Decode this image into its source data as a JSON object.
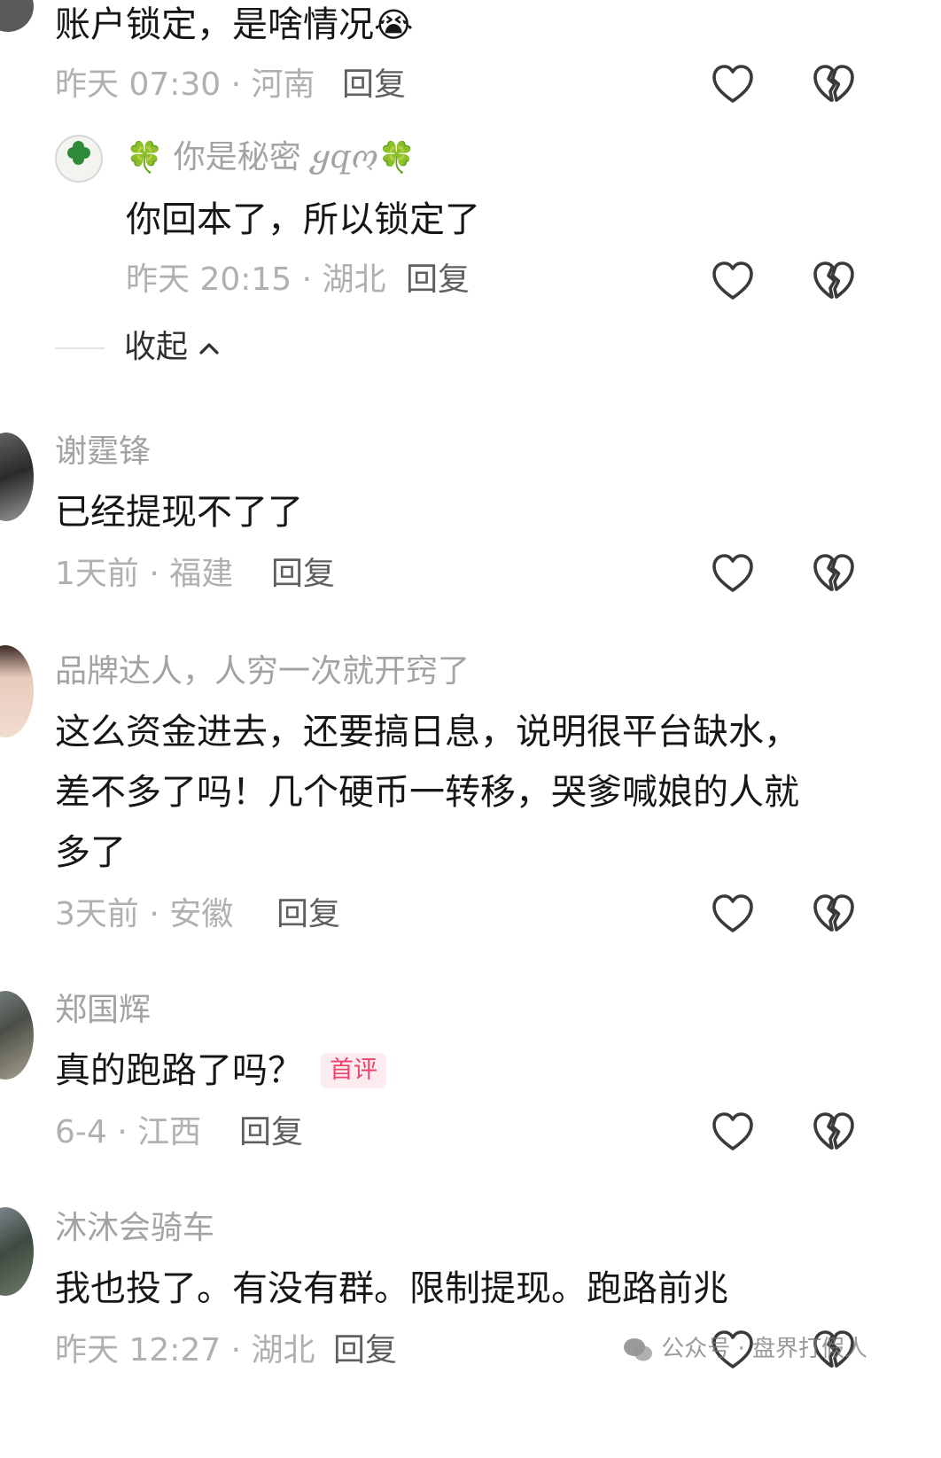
{
  "comments": [
    {
      "text": "账户锁定，是啥情况",
      "emoji": "😭",
      "meta": "昨天 07:30 · 河南",
      "reply": "回复",
      "replies": [
        {
          "user_prefix": "🍀",
          "user": "你是秘密",
          "user_suffix_script": "ყզო",
          "user_suffix": "🍀",
          "text": "你回本了，所以锁定了",
          "meta": "昨天 20:15 · 湖北",
          "reply": "回复"
        }
      ],
      "collapse": "收起",
      "collapse_icon": "chevron-up-icon"
    },
    {
      "user": "谢霆锋",
      "text": "已经提现不了了",
      "meta": "1天前 · 福建",
      "reply": "回复"
    },
    {
      "user": "品牌达人，人穷一次就开窍了",
      "text_lines": [
        "这么资金进去，还要搞日息，说明很平台缺水，",
        "差不多了吗！几个硬币一转移，哭爹喊娘的人就",
        "多了"
      ],
      "meta": "3天前 · 安徽",
      "reply": "回复"
    },
    {
      "user": "郑国辉",
      "text": "真的跑路了吗？",
      "badge": "首评",
      "meta": "6-4 · 江西",
      "reply": "回复"
    },
    {
      "user": "沐沐会骑车",
      "text": "我也投了。有没有群。限制提现。跑路前兆",
      "meta": "昨天 12:27 · 湖北",
      "reply": "回复"
    }
  ],
  "watermark": {
    "icon": "wechat-icon",
    "text": "公众号 · 盘界打假人"
  },
  "icons": {
    "like": "heart-icon",
    "dislike": "broken-heart-icon"
  },
  "colors": {
    "meta": "#b0b0b0",
    "name": "#a3a3a3",
    "badge_bg": "#fdecef",
    "badge_fg": "#f0436b"
  }
}
